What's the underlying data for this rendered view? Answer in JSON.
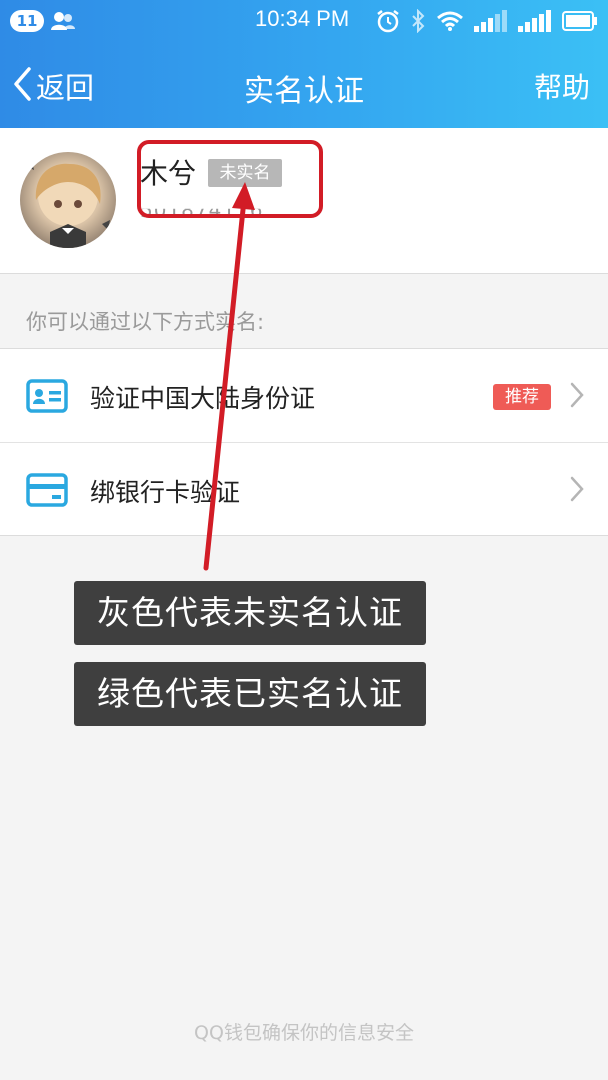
{
  "status_bar": {
    "notification_count": "11",
    "time": "10:34 PM"
  },
  "nav": {
    "back_label": "返回",
    "title": "实名认证",
    "help_label": "帮助"
  },
  "profile": {
    "name": "木兮",
    "verify_status": "未实名",
    "account": "501874116"
  },
  "section_hint": "你可以通过以下方式实名:",
  "options": [
    {
      "label": "验证中国大陆身份证",
      "icon": "id-card-icon",
      "badge": "推荐"
    },
    {
      "label": "绑银行卡验证",
      "icon": "bank-card-icon"
    }
  ],
  "annotations": {
    "gray_note": "灰色代表未实名认证",
    "green_note": "绿色代表已实名认证"
  },
  "footer": "QQ钱包确保你的信息安全",
  "colors": {
    "header_start": "#2f8be6",
    "header_end": "#3bc0f5",
    "icon_blue": "#2aa8e0",
    "badge_red": "#ef5b56",
    "unverified_gray": "#b7b7b7",
    "annotation_red": "#d21c26"
  }
}
